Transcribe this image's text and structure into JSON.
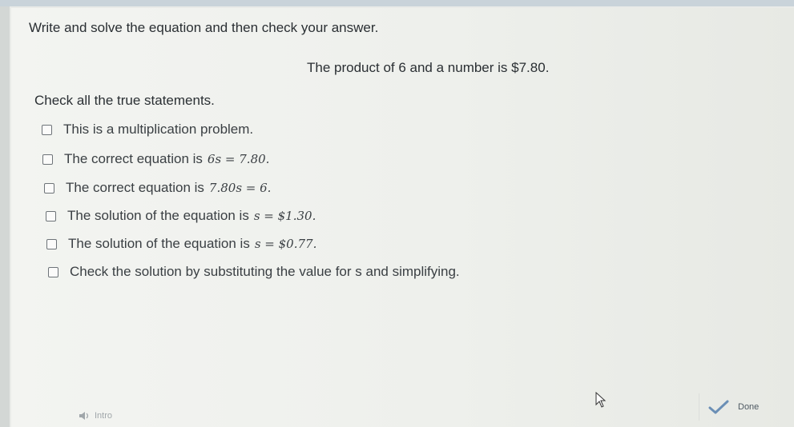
{
  "question": {
    "instruction": "Write and solve the equation and then check your answer.",
    "problem": "The product of 6 and a number is $7.80.",
    "prompt": "Check all the true statements."
  },
  "options": [
    {
      "text": "This is a multiplication problem.",
      "math": ""
    },
    {
      "text": "The correct equation is",
      "math": "6s = 7.80."
    },
    {
      "text": "The correct equation is",
      "math": "7.80s = 6."
    },
    {
      "text": "The solution of the equation is",
      "math": "s = $1.30."
    },
    {
      "text": "The solution of the equation is",
      "math": "s = $0.77."
    },
    {
      "text": "Check the solution by substituting the value for s and simplifying.",
      "math": ""
    }
  ],
  "footer": {
    "done_label": "Done",
    "intro_label": "Intro"
  },
  "icons": {
    "done": "check-icon",
    "intro": "speaker-icon",
    "pointer": "cursor-icon"
  },
  "colors": {
    "check_accent": "#6b8fb6"
  }
}
